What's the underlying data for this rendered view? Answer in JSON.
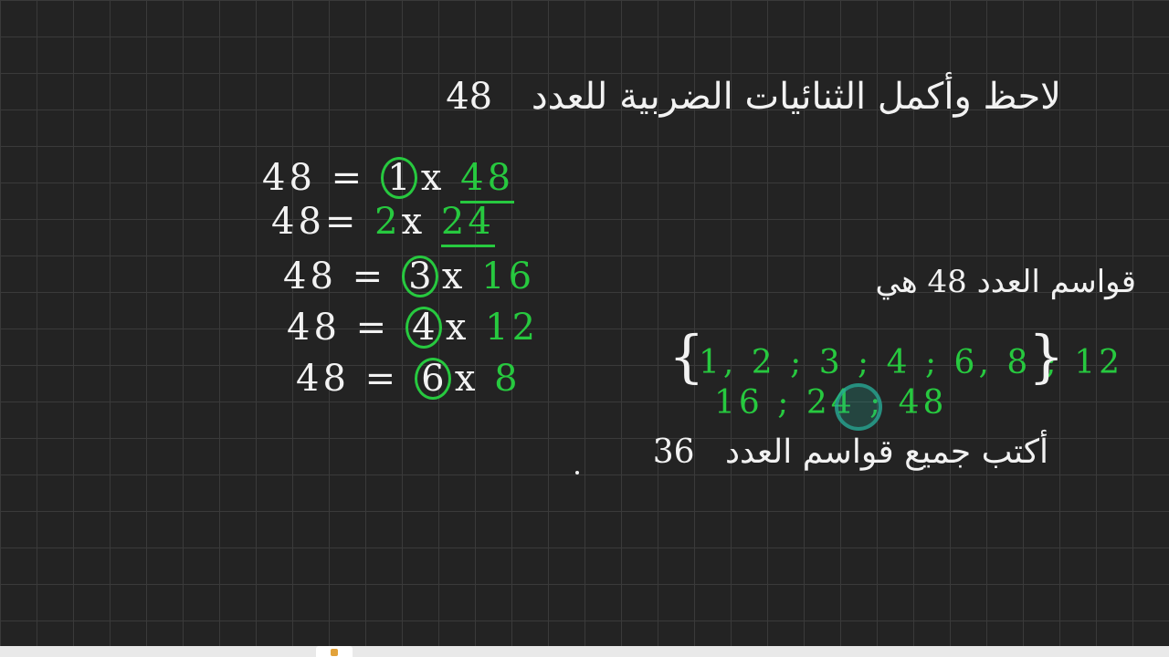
{
  "title": {
    "text": "لاحظ وأكمل الثنائيات الضربية للعدد",
    "number": "48"
  },
  "equations": [
    {
      "left": "48",
      "op": "=",
      "a": "1",
      "x": "x",
      "b": "48"
    },
    {
      "left": "48",
      "op": "=",
      "a": "2",
      "x": "x",
      "b": "24"
    },
    {
      "left": "48",
      "op": "=",
      "a": "3",
      "x": "x",
      "b": "16"
    },
    {
      "left": "48",
      "op": "=",
      "a": "4",
      "x": "x",
      "b": "12"
    },
    {
      "left": "48",
      "op": "=",
      "a": "6",
      "x": "x",
      "b": "8"
    }
  ],
  "factors": {
    "label": "قواسم العدد 48 هي",
    "open": "{",
    "close": "}",
    "row1": "1, 2 ; 3 ; 4 ; 6, 8 ; 12",
    "row2": "16 ; 24 ; 48"
  },
  "question": {
    "text": "أكتب جميع قواسم العدد",
    "number": "36"
  },
  "colors": {
    "board": "#232323",
    "grid": "#3a3a3a",
    "chalk": "#f2f2f2",
    "green": "#27c93f"
  }
}
